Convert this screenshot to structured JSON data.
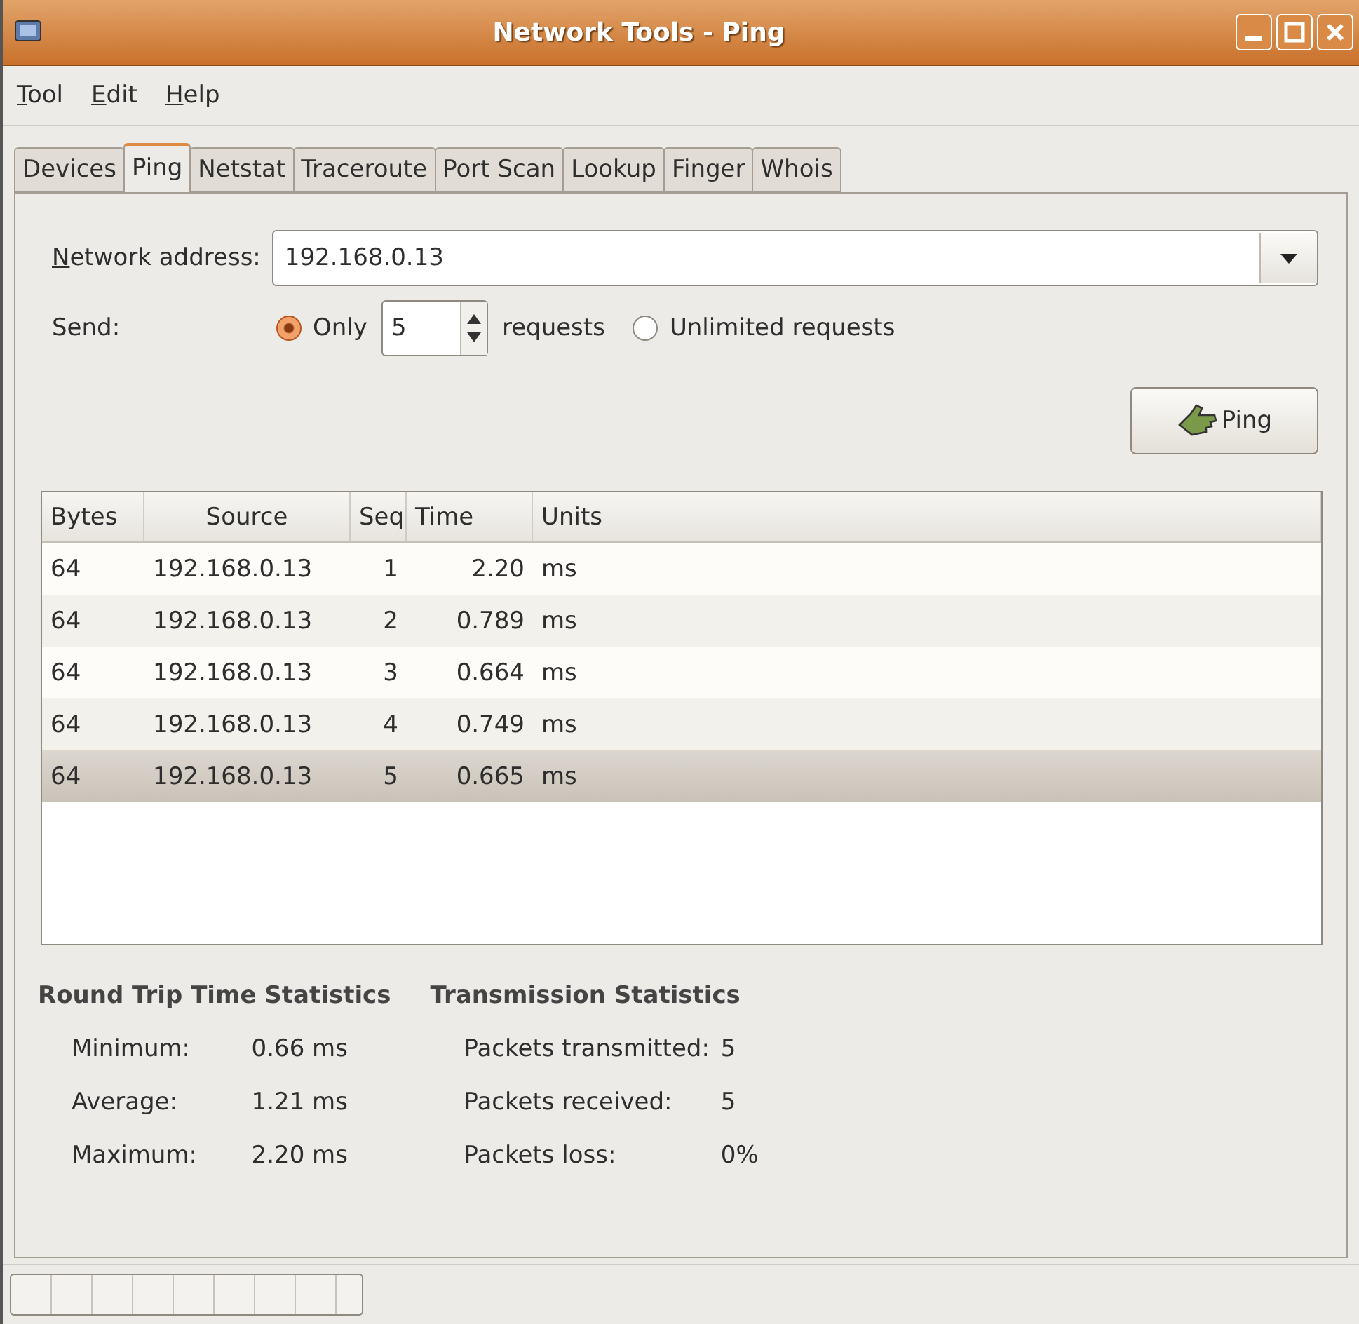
{
  "window": {
    "title": "Network Tools - Ping"
  },
  "menu": [
    "Tool",
    "Edit",
    "Help"
  ],
  "tabs": [
    {
      "label": "Devices",
      "selected": false
    },
    {
      "label": "Ping",
      "selected": true
    },
    {
      "label": "Netstat",
      "selected": false
    },
    {
      "label": "Traceroute",
      "selected": false
    },
    {
      "label": "Port Scan",
      "selected": false
    },
    {
      "label": "Lookup",
      "selected": false
    },
    {
      "label": "Finger",
      "selected": false
    },
    {
      "label": "Whois",
      "selected": false
    }
  ],
  "address": {
    "label": "Network address:",
    "value": "192.168.0.13"
  },
  "send": {
    "label": "Send:",
    "options": [
      {
        "label": "Only",
        "selected": true,
        "count": "5",
        "suffix": "requests"
      },
      {
        "label": "Unlimited requests",
        "selected": false
      }
    ]
  },
  "ping_button": "Ping",
  "table": {
    "columns": [
      "Bytes",
      "Source",
      "Seq",
      "Time",
      "Units"
    ],
    "rows": [
      {
        "cells": [
          "64",
          "192.168.0.13",
          "1",
          "2.20",
          "ms"
        ],
        "selected": false
      },
      {
        "cells": [
          "64",
          "192.168.0.13",
          "2",
          "0.789",
          "ms"
        ],
        "selected": false
      },
      {
        "cells": [
          "64",
          "192.168.0.13",
          "3",
          "0.664",
          "ms"
        ],
        "selected": false
      },
      {
        "cells": [
          "64",
          "192.168.0.13",
          "4",
          "0.749",
          "ms"
        ],
        "selected": false
      },
      {
        "cells": [
          "64",
          "192.168.0.13",
          "5",
          "0.665",
          "ms"
        ],
        "selected": true
      }
    ]
  },
  "round_trip": {
    "title": "Round Trip Time Statistics",
    "rows": [
      {
        "label": "Minimum:",
        "value": "0.66 ms"
      },
      {
        "label": "Average:",
        "value": "1.21 ms"
      },
      {
        "label": "Maximum:",
        "value": "2.20 ms"
      }
    ]
  },
  "transmission": {
    "title": "Transmission Statistics",
    "rows": [
      {
        "label": "Packets transmitted:",
        "value": "5"
      },
      {
        "label": "Packets received:",
        "value": "5"
      },
      {
        "label": "Packets loss:",
        "value": "0%"
      }
    ]
  },
  "status_bar": {
    "progress": {
      "level": 0
    }
  }
}
